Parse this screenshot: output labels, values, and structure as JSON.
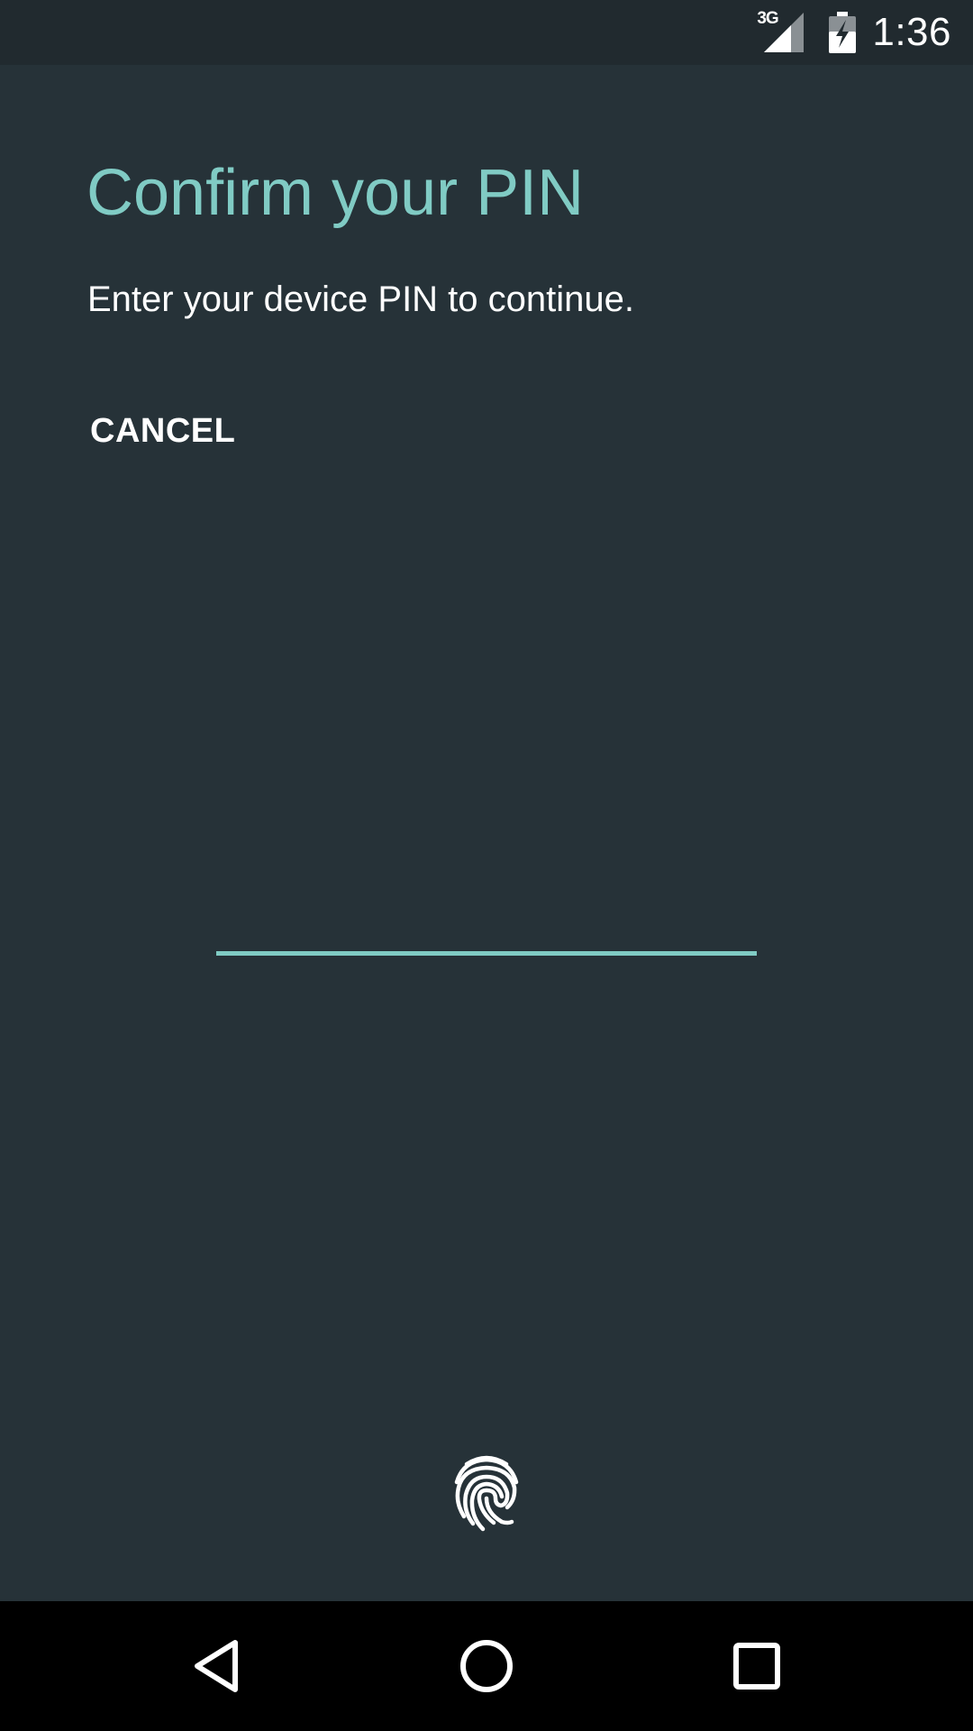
{
  "status_bar": {
    "network_type": "3G",
    "time": "1:36",
    "icons": [
      "signal-icon",
      "battery-charging-icon"
    ]
  },
  "screen": {
    "title": "Confirm your PIN",
    "subtitle": "Enter your device PIN to continue.",
    "cancel_label": "CANCEL",
    "pin_value": ""
  },
  "fingerprint": {
    "icon": "fingerprint-icon"
  },
  "navigation": {
    "icons": [
      "back-icon",
      "home-icon",
      "recents-icon"
    ]
  },
  "colors": {
    "background": "#263238",
    "status_bar": "#212A2F",
    "accent": "#80CBC4",
    "text": "#FFFFFF",
    "nav_bar": "#000000"
  }
}
